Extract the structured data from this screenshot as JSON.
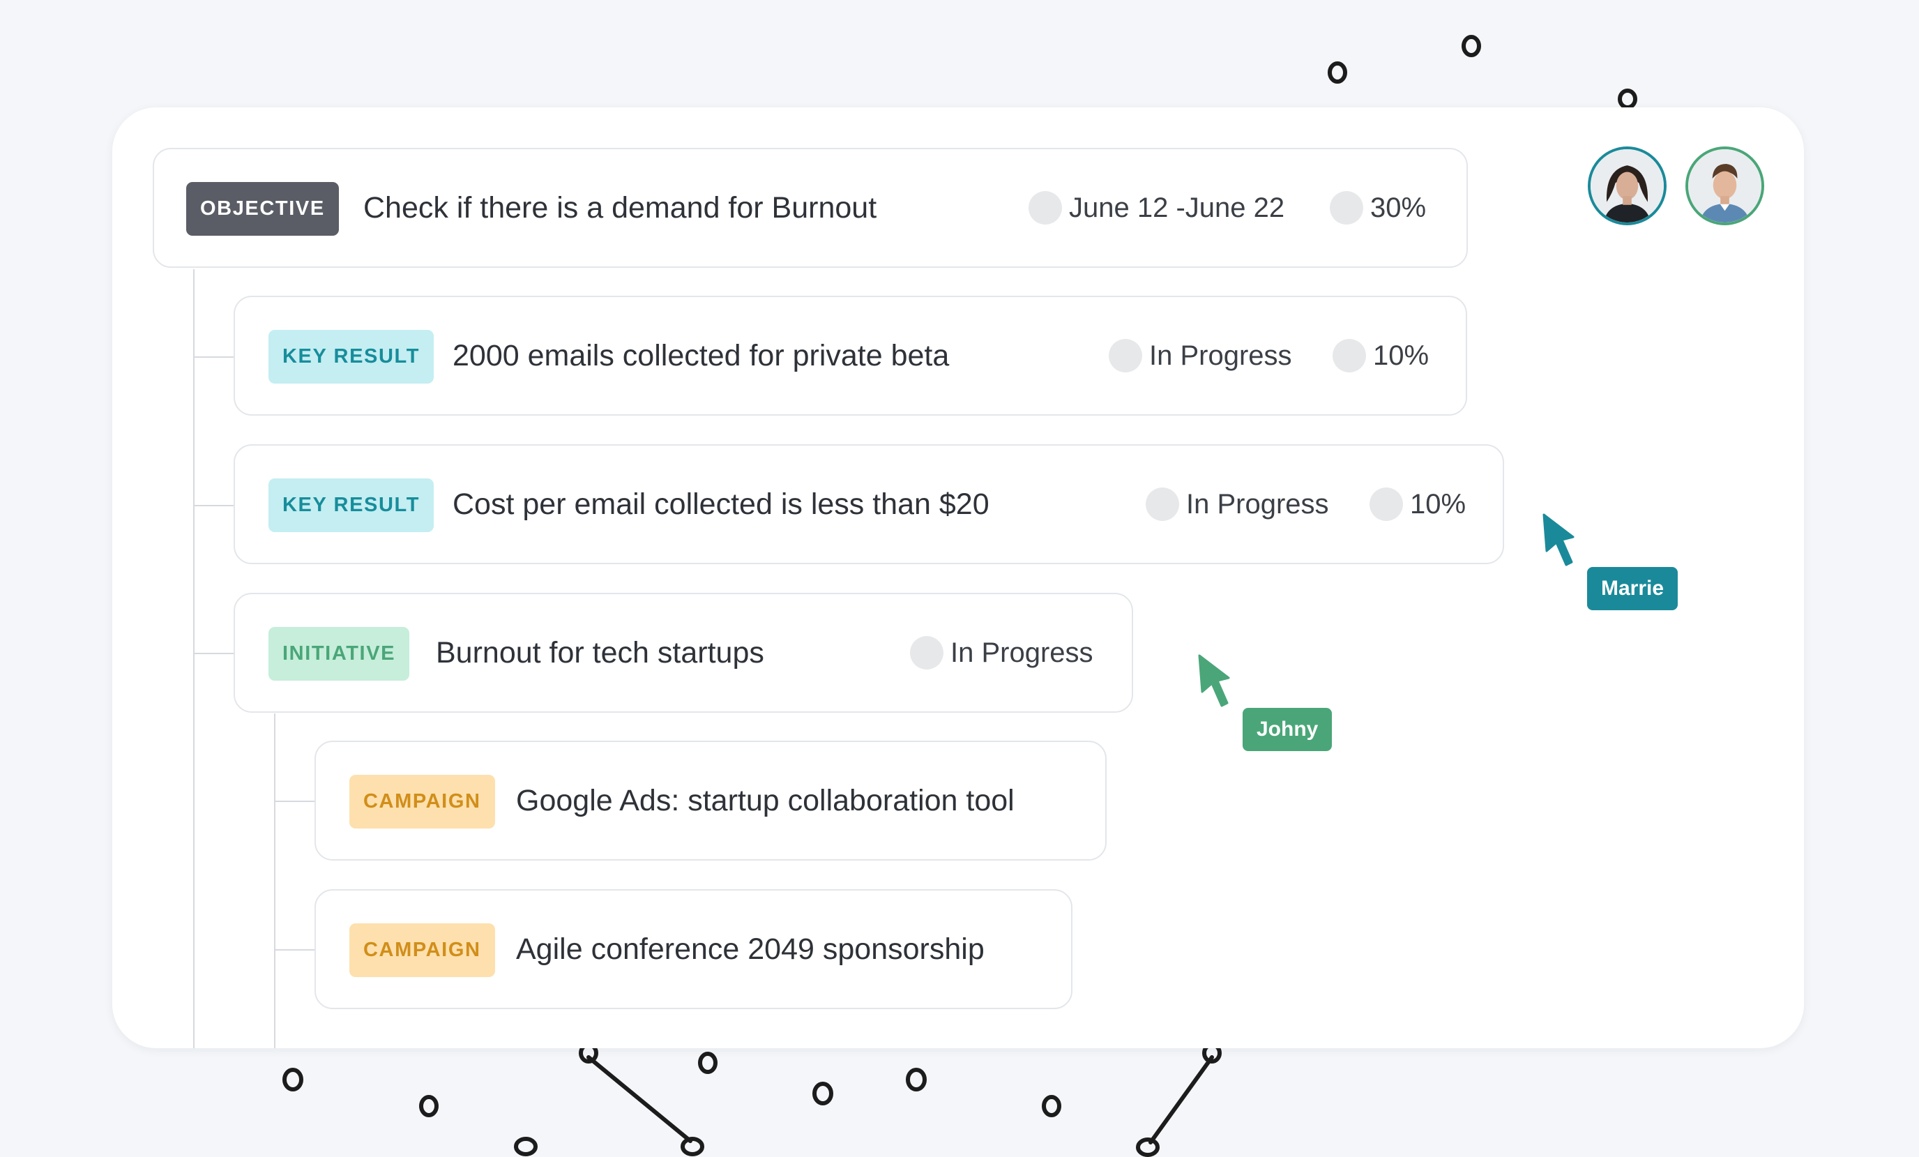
{
  "objective": {
    "tag": "OBJECTIVE",
    "title": "Check if there is a demand for Burnout",
    "date_range": "June 12 -June 22",
    "progress": "30%"
  },
  "key_results": [
    {
      "tag": "KEY RESULT",
      "title": "2000 emails collected for private beta",
      "status": "In Progress",
      "progress": "10%"
    },
    {
      "tag": "KEY RESULT",
      "title": "Cost per email collected is less than $20",
      "status": "In Progress",
      "progress": "10%"
    }
  ],
  "initiative": {
    "tag": "INITIATIVE",
    "title": "Burnout for tech startups",
    "status": "In Progress"
  },
  "campaigns": [
    {
      "tag": "CAMPAIGN",
      "title": "Google Ads: startup collaboration tool"
    },
    {
      "tag": "CAMPAIGN",
      "title": "Agile conference 2049 sponsorship"
    }
  ],
  "collaborators": [
    {
      "name": "Marrie",
      "color": "#1a8a9a"
    },
    {
      "name": "Johny",
      "color": "#4aa678"
    }
  ],
  "avatars": [
    {
      "icon": "woman-avatar",
      "ring_color": "#1a8a9a"
    },
    {
      "icon": "man-avatar",
      "ring_color": "#4aa678"
    }
  ]
}
